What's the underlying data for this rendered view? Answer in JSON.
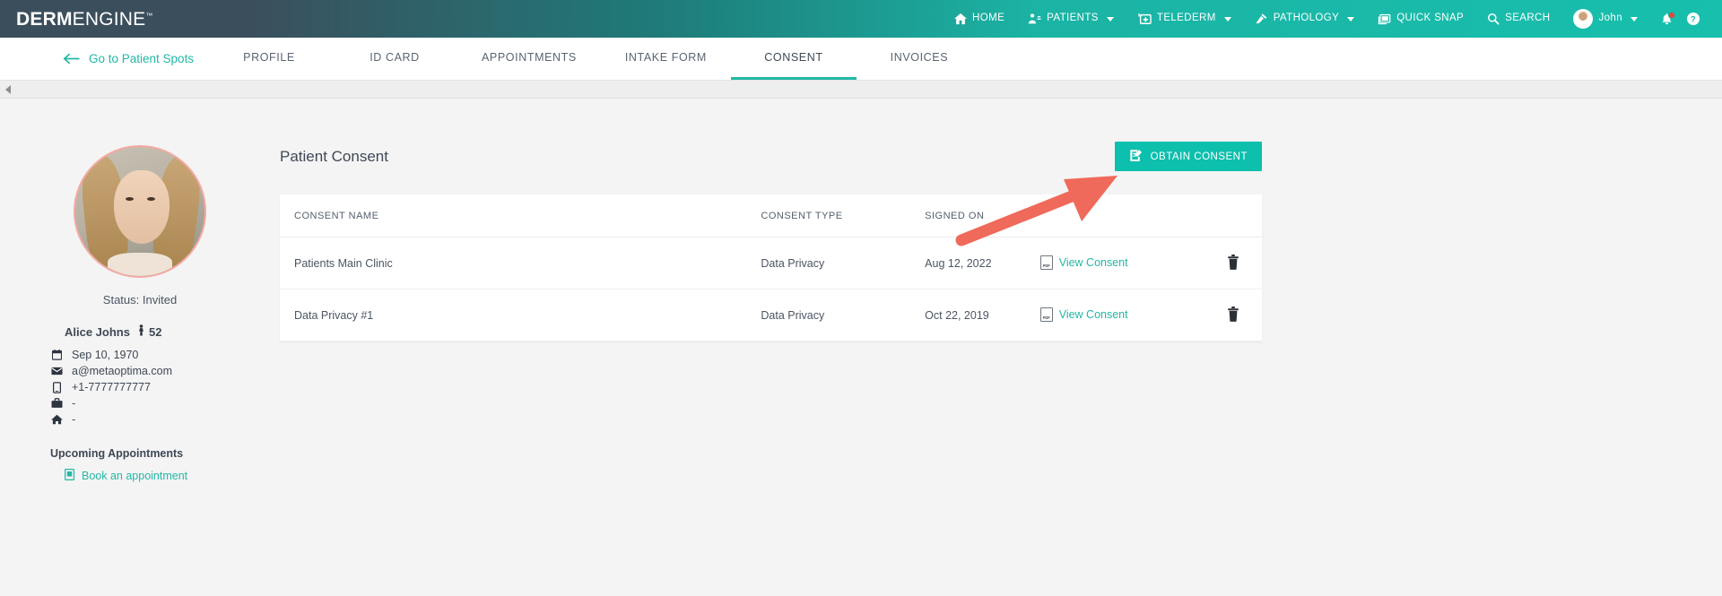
{
  "app": {
    "logo_bold": "DERM",
    "logo_light": "ENGINE",
    "logo_tm": "™"
  },
  "topnav": {
    "items": [
      {
        "label": "HOME",
        "icon": "home-icon",
        "caret": false
      },
      {
        "label": "PATIENTS",
        "icon": "patients-icon",
        "caret": true
      },
      {
        "label": "TELEDERM",
        "icon": "telederm-icon",
        "caret": true
      },
      {
        "label": "PATHOLOGY",
        "icon": "pathology-icon",
        "caret": true
      },
      {
        "label": "QUICK SNAP",
        "icon": "camera-icon",
        "caret": false
      },
      {
        "label": "SEARCH",
        "icon": "search-icon",
        "caret": false
      }
    ],
    "user": {
      "name": "John",
      "caret": true,
      "avatar": "user-avatar"
    },
    "bell": "notifications-bell-icon",
    "help": "help-icon",
    "brand_teal": "#1bb3a4",
    "brand_dark": "#3b4e5c"
  },
  "tabbar": {
    "back_label": "Go to Patient Spots",
    "back_icon": "arrow-left-icon",
    "tabs": [
      {
        "label": "PROFILE",
        "active": false
      },
      {
        "label": "ID CARD",
        "active": false
      },
      {
        "label": "APPOINTMENTS",
        "active": false
      },
      {
        "label": "INTAKE FORM",
        "active": false
      },
      {
        "label": "CONSENT",
        "active": true
      },
      {
        "label": "INVOICES",
        "active": false
      }
    ],
    "active_color": "#23b7a6"
  },
  "patient": {
    "status": "Status: Invited",
    "name": "Alice Johns",
    "age": "52",
    "birthdate": "Sep 10, 1970",
    "email": "a@metaoptima.com",
    "phone": "+1-7777777777",
    "work": "-",
    "home": "-",
    "upcoming_title": "Upcoming Appointments",
    "book_label": "Book an appointment"
  },
  "consent_panel": {
    "title": "Patient Consent",
    "obtain_button": "OBTAIN CONSENT",
    "obtain_icon": "document-edit-icon",
    "columns": [
      "CONSENT NAME",
      "CONSENT TYPE",
      "SIGNED ON",
      "",
      ""
    ],
    "rows": [
      {
        "name": "Patients Main Clinic",
        "type": "Data Privacy",
        "signed_on": "Aug 12, 2022",
        "view_label": "View Consent",
        "view_icon": "pdf-icon",
        "delete_icon": "trash-icon"
      },
      {
        "name": "Data Privacy #1",
        "type": "Data Privacy",
        "signed_on": "Oct 22, 2019",
        "view_label": "View Consent",
        "view_icon": "pdf-icon",
        "delete_icon": "trash-icon"
      }
    ]
  },
  "annotation": {
    "type": "arrow",
    "color": "#ef6a5a",
    "points_to": "obtain-consent-button"
  }
}
